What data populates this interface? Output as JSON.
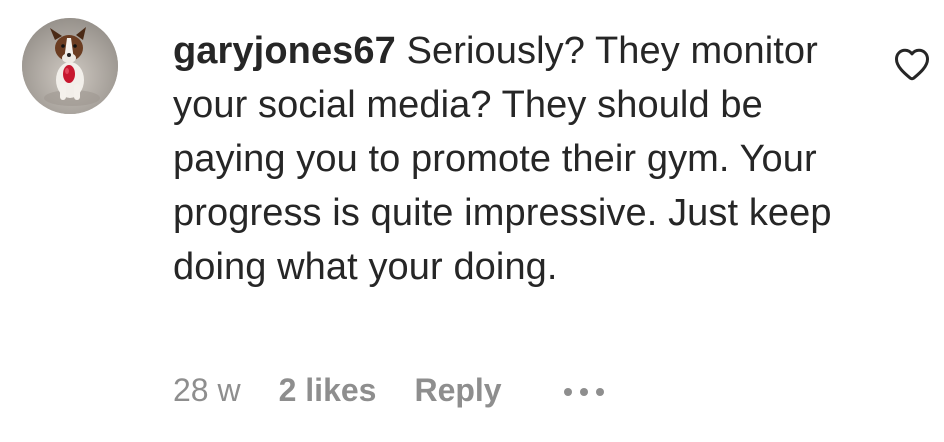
{
  "comment": {
    "username": "garyjones67",
    "text": "Seriously? They monitor your social media? They should be paying you to promote their gym. Your progress is quite impressive. Just keep doing what your doing.",
    "time": "28 w",
    "likes": "2 likes",
    "reply_label": "Reply",
    "more_icon": "more-horizontal-icon",
    "like_icon": "heart-outline-icon"
  },
  "colors": {
    "text": "#262626",
    "secondary": "#8e8e8e",
    "background": "#ffffff"
  }
}
